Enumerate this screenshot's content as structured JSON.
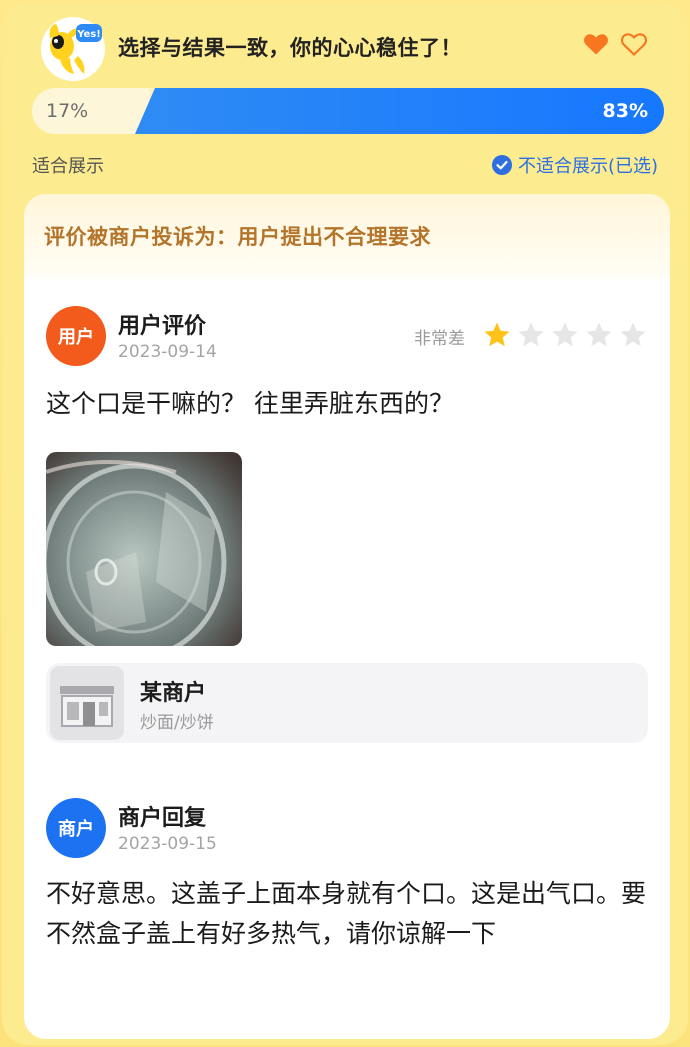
{
  "header": {
    "title": "选择与结果一致，你的心心稳住了！"
  },
  "vote": {
    "left_percent": 17,
    "left_label": "17%",
    "right_percent": 83,
    "right_label": "83%",
    "option_left": "适合展示",
    "option_right": "不适合展示(已选)"
  },
  "complaint": {
    "text": "评价被商户投诉为：用户提出不合理要求"
  },
  "review": {
    "avatar_text": "用户",
    "name": "用户评价",
    "date": "2023-09-14",
    "rating_label": "非常差",
    "rating": 1,
    "rating_max": 5,
    "text": "这个口是干嘛的？  往里弄脏东西的？"
  },
  "shop": {
    "name": "某商户",
    "category": "炒面/炒饼"
  },
  "reply": {
    "avatar_text": "商户",
    "name": "商户回复",
    "date": "2023-09-15",
    "text": "不好意思。这盖子上面本身就有个口。这是出气口。要不然盒子盖上有好多热气，请你谅解一下"
  },
  "colors": {
    "accent_blue": "#1677ff",
    "heart_orange": "#f7761f",
    "user_avatar": "#f25b1c",
    "merchant_avatar": "#1d72f2",
    "complaint_text": "#b3742b",
    "star_filled": "#ffc21a",
    "star_empty": "#e6e6e6"
  },
  "icons": {
    "mascot": "mascot-logo-icon",
    "heart_filled": "heart-filled-icon",
    "heart_outline": "heart-outline-icon",
    "check": "check-circle-icon",
    "star": "star-icon",
    "shop": "storefront-icon"
  }
}
